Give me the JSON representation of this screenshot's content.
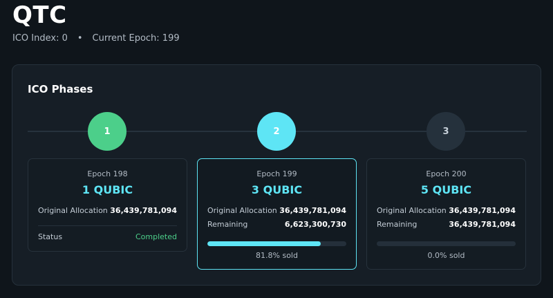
{
  "header": {
    "title": "QTC",
    "ico_index": "ICO Index: 0",
    "separator": "•",
    "current_epoch": "Current Epoch: 199"
  },
  "panel": {
    "title": "ICO Phases"
  },
  "phases": [
    {
      "step": "1",
      "epoch": "Epoch 198",
      "price": "1 QUBIC",
      "allocation_label": "Original Allocation",
      "allocation_value": "36,439,781,094",
      "status_label": "Status",
      "status_value": "Completed",
      "step_color": "#4ccf8a"
    },
    {
      "step": "2",
      "epoch": "Epoch 199",
      "price": "3 QUBIC",
      "allocation_label": "Original Allocation",
      "allocation_value": "36,439,781,094",
      "remaining_label": "Remaining",
      "remaining_value": "6,623,300,730",
      "sold_fraction": 0.818,
      "sold_text": "81.8% sold",
      "step_color": "#5ee5f5"
    },
    {
      "step": "3",
      "epoch": "Epoch 200",
      "price": "5 QUBIC",
      "allocation_label": "Original Allocation",
      "allocation_value": "36,439,781,094",
      "remaining_label": "Remaining",
      "remaining_value": "36,439,781,094",
      "sold_fraction": 0.0,
      "sold_text": "0.0% sold",
      "step_color": "#25313c"
    }
  ],
  "colors": {
    "accent": "#5ee5f5",
    "success": "#4ccf8a",
    "background": "#0f151b",
    "panel": "#161e26"
  }
}
